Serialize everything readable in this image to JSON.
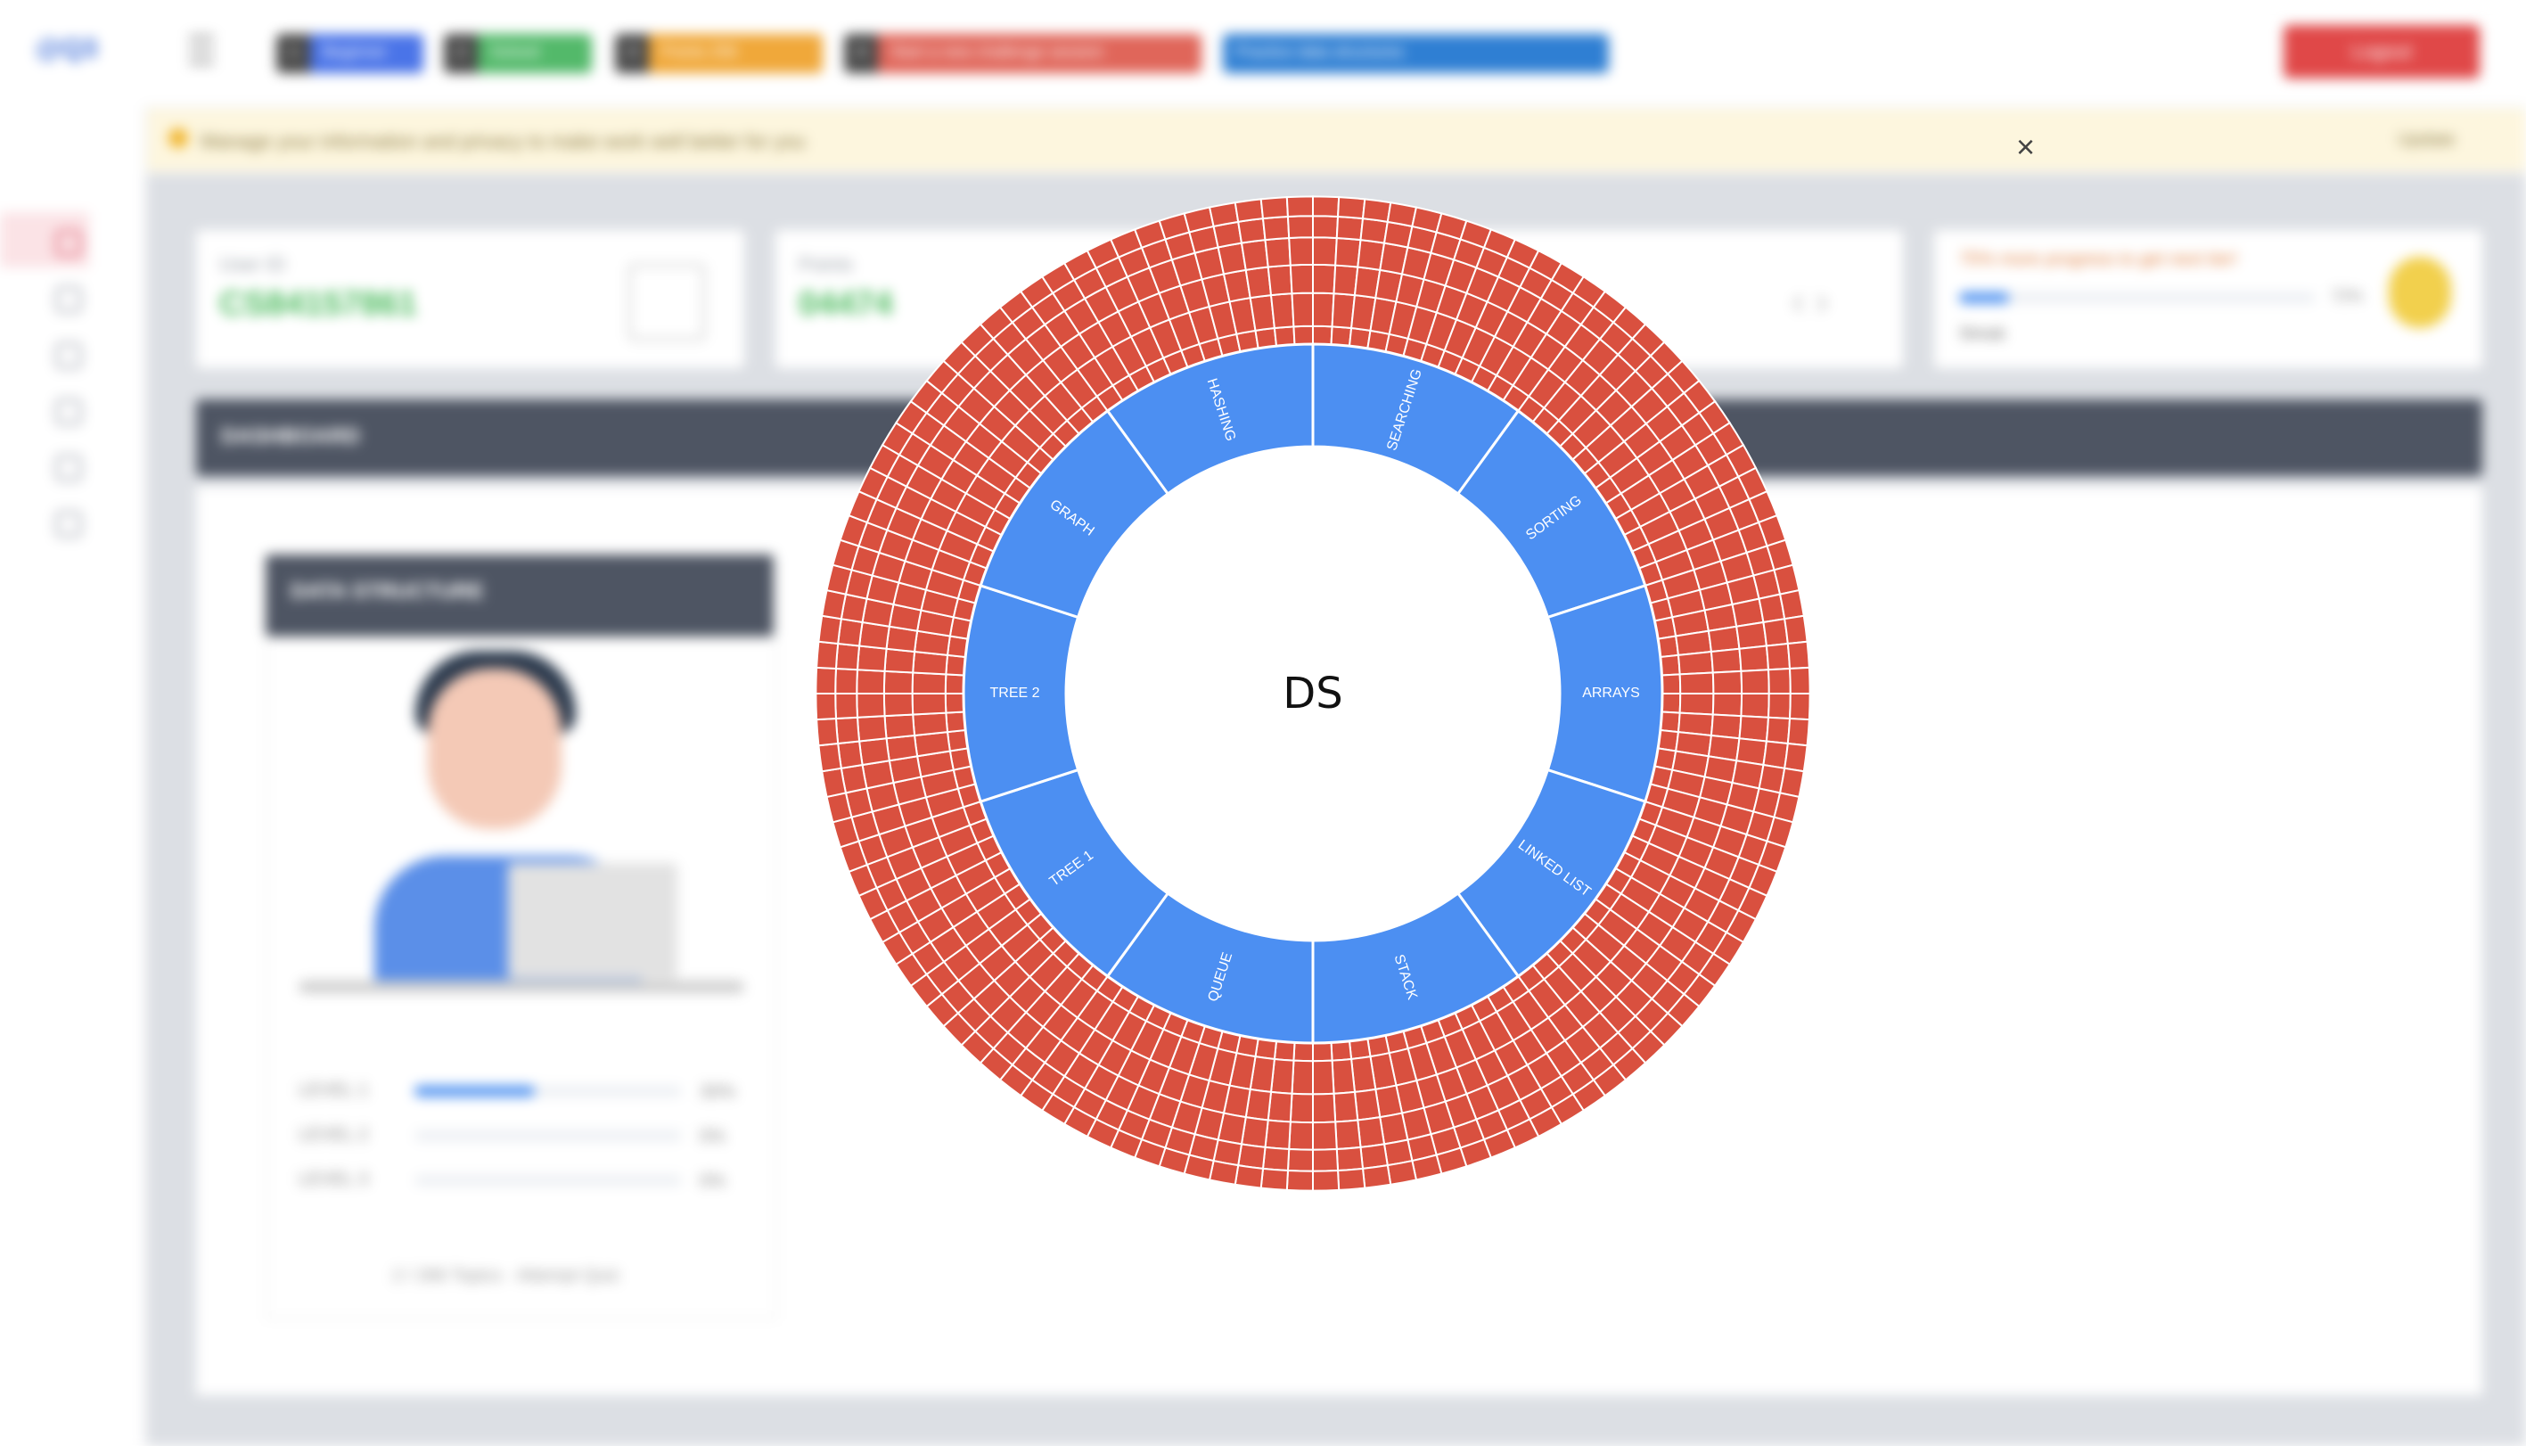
{
  "background": {
    "logo": "@Q3",
    "pills": [
      {
        "key": "1",
        "value": "Beginner",
        "color": "#4a74e8"
      },
      {
        "key": "2",
        "value": "Solved",
        "color": "#53b96a"
      },
      {
        "key": "3",
        "value": "Points 256",
        "color": "#f0a83a"
      },
      {
        "key": "4",
        "value": "Start a new challenge session",
        "color": "#e0665a"
      },
      {
        "key": "",
        "value": "Practice data structures",
        "color": "#2f7fd3"
      }
    ],
    "logout_label": "Logout",
    "banner_text": "Manage your information and privacy to make work well better for you",
    "banner_action": "Update",
    "cards": [
      {
        "label": "User ID",
        "value": "CS84157861"
      },
      {
        "label": "Points",
        "value": "04474"
      }
    ],
    "progress_card": {
      "title": "75% more progress to get next tier!",
      "percent_label": "72%",
      "streak_label": "Streak"
    },
    "dashboard_label": "DASHBOARD",
    "ds_panel_title": "DATA STRUCTURE",
    "levels": [
      {
        "label": "LEVEL 1",
        "pct": "30%",
        "fill": 0.45
      },
      {
        "label": "LEVEL 2",
        "pct": "0%",
        "fill": 0
      },
      {
        "label": "LEVEL 3",
        "pct": "0%",
        "fill": 0
      }
    ],
    "footer_text": "2 / 266 Topics · Attempt Quiz"
  },
  "overlay": {
    "close_label": "×",
    "center_label": "DS",
    "categories": [
      "HASHING",
      "SEARCHING",
      "SORTING",
      "ARRAYS",
      "LINKED LIST",
      "STACK",
      "QUEUE",
      "TREE 1",
      "TREE 2",
      "GRAPH"
    ],
    "status_colors": {
      "solved": "#6acb79",
      "attempted": "#e9c441",
      "unsolved": "#d9503f",
      "category": "#4c8ff2"
    },
    "inner_ring_statuses": [
      "A",
      "A",
      "A",
      "A",
      "S",
      "A",
      "S",
      "S",
      "A",
      "S",
      "S",
      "S",
      "S",
      "S",
      "A",
      "S",
      "S",
      "S",
      "A",
      "A",
      "A",
      "S",
      "S",
      "S",
      "S",
      "A",
      "A",
      "A",
      "S",
      "S",
      "A",
      "A",
      "A",
      "S",
      "A",
      "A",
      "S",
      "S",
      "A",
      "S",
      "S",
      "A",
      "A",
      "A",
      "U",
      "A",
      "S",
      "S",
      "S",
      "A",
      "A",
      "S",
      "S",
      "S",
      "A",
      "S",
      "A",
      "S",
      "S",
      "S",
      "S",
      "S",
      "A",
      "S",
      "A",
      "A",
      "A",
      "S",
      "A",
      "S",
      "A",
      "S",
      "S",
      "A",
      "S",
      "A",
      "A",
      "A",
      "A",
      "A",
      "S",
      "A",
      "S",
      "A",
      "A",
      "A",
      "S",
      "A",
      "S",
      "S",
      "U",
      "A",
      "S",
      "A",
      "A",
      "A",
      "A",
      "S",
      "A",
      "S",
      "S",
      "A",
      "S",
      "A",
      "S",
      "A",
      "S",
      "A",
      "A",
      "S",
      "A",
      "S",
      "A",
      "S",
      "S",
      "A",
      "S",
      "A",
      "A",
      "S"
    ]
  }
}
